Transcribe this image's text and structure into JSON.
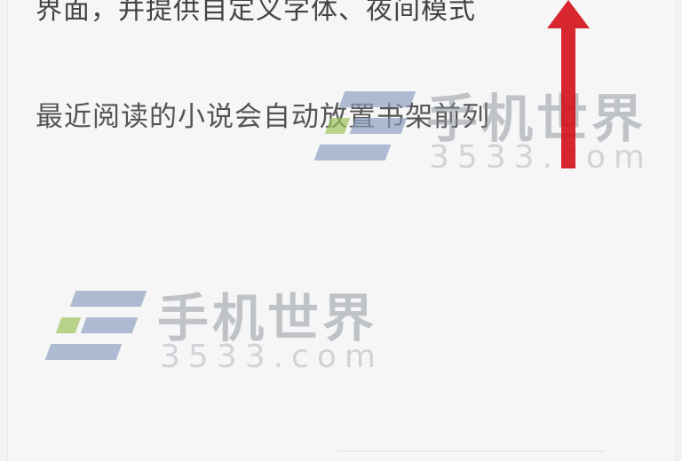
{
  "page": {
    "top_text": "界面，并提供自定义字体、夜间模式",
    "hint_text": "最近阅读的小说会自动放置书架前列"
  },
  "watermark": {
    "name": "手机世界",
    "domain": "3533.com"
  },
  "colors": {
    "arrow": "#d4141c",
    "watermark_bar": "#8799bd",
    "watermark_green": "#9ec55b"
  },
  "icons": {
    "arrow": "arrow-up-icon",
    "logo": "watermark-logo"
  }
}
